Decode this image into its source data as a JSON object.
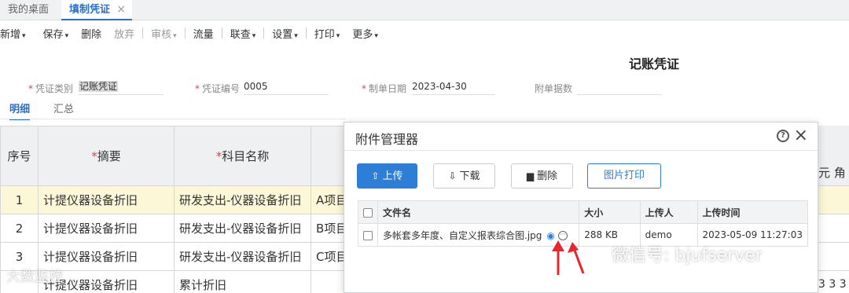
{
  "tabs": [
    {
      "label": "我的桌面"
    },
    {
      "label": "填制凭证"
    }
  ],
  "tab_close_glyph": "×",
  "toolbar": {
    "add": "新增",
    "save": "保存",
    "delete": "删除",
    "abandon": "放弃",
    "review": "审核",
    "flow": "流量",
    "link": "联查",
    "settings": "设置",
    "print": "打印",
    "more": "更多",
    "caret": "▾"
  },
  "form": {
    "title": "记账凭证",
    "type_label": "凭证类别",
    "type_value": "记账凭证",
    "no_label": "凭证编号",
    "no_value": "0005",
    "date_label": "制单日期",
    "date_value": "2023-04-30",
    "attach_label": "附单据数",
    "required_mark": "*"
  },
  "subtabs": [
    "明细",
    "汇总"
  ],
  "grid": {
    "headers": {
      "seq": "序号",
      "summary": "摘要",
      "subject": "科目名称",
      "right_partial": "元 角 分"
    },
    "rows": [
      {
        "seq": "1",
        "summary": "计提仪器设备折旧",
        "subject": "研发支出-仪器设备折旧",
        "extra": "A项目"
      },
      {
        "seq": "2",
        "summary": "计提仪器设备折旧",
        "subject": "研发支出-仪器设备折旧",
        "extra": "B项目"
      },
      {
        "seq": "3",
        "summary": "计提仪器设备折旧",
        "subject": "研发支出-仪器设备折旧",
        "extra": "C项目"
      },
      {
        "seq": "",
        "summary": "计提仪器设备折旧",
        "subject": "累计折旧",
        "extra": ""
      }
    ],
    "right_tail": "3 3 3"
  },
  "modal": {
    "title": "附件管理器",
    "help": "?",
    "close": "×",
    "buttons": {
      "upload": "上传",
      "download": "下载",
      "delete": "删除",
      "print": "图片打印"
    },
    "columns": {
      "name": "文件名",
      "size": "大小",
      "uploader": "上传人",
      "time": "上传时间"
    },
    "files": [
      {
        "name": "多帐套多年度、自定义报表综合图.jpg",
        "size": "288 KB",
        "uploader": "demo",
        "time": "2023-05-09 11:27:03"
      }
    ]
  },
  "watermarks": {
    "left": "大数监控",
    "right": "微信号: bjufserver"
  },
  "colors": {
    "accent": "#2c7ed6",
    "required": "#e64242",
    "selected_row": "#fcf7d6",
    "arrow": "#e8262b"
  }
}
